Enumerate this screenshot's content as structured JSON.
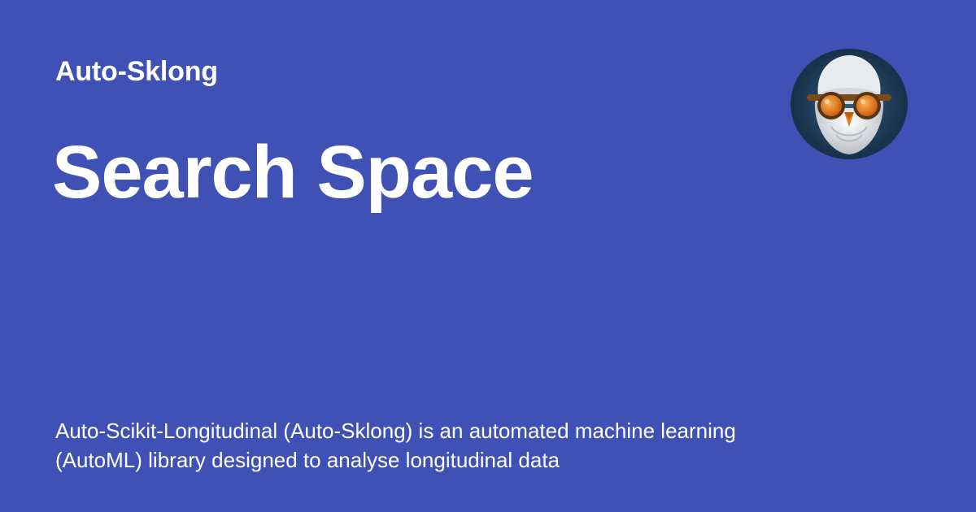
{
  "site": {
    "name": "Auto-Sklong"
  },
  "page": {
    "title": "Search Space",
    "description": "Auto-Scikit-Longitudinal (Auto-Sklong) is an automated machine learning (AutoML) library designed to analyse longitudinal data"
  },
  "logo": {
    "icon": "bearded-owl-avatar-icon"
  },
  "colors": {
    "background": "#3f51b5",
    "text": "#ffffff",
    "logo_bg": "#1e3a5c",
    "goggles": "#e07a1a"
  }
}
